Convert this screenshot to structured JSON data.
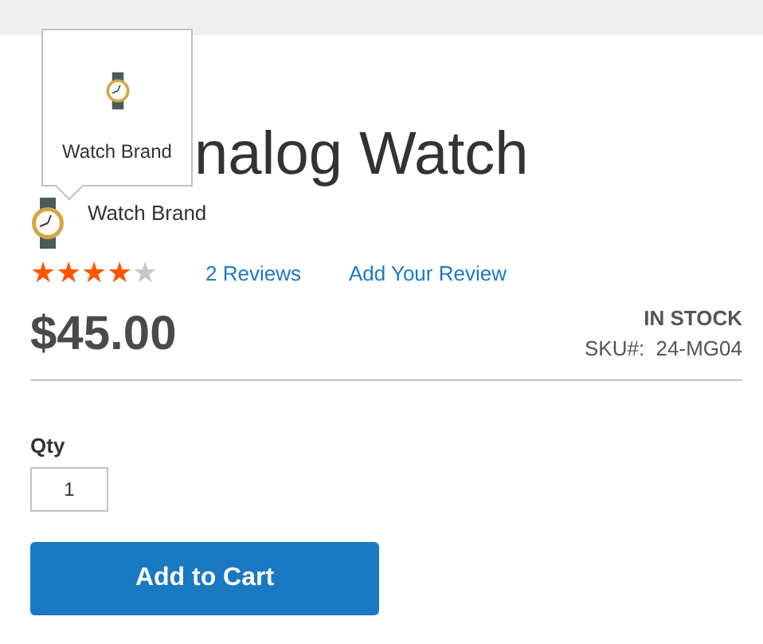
{
  "product": {
    "title": "nalog Watch",
    "brand": {
      "name": "Watch Brand"
    },
    "rating": {
      "stars": 4
    },
    "reviews_link": "2  Reviews",
    "add_review_link": "Add Your Review",
    "price": "$45.00",
    "stock": "IN STOCK",
    "sku_label": "SKU#:",
    "sku": "24-MG04"
  },
  "tooltip": {
    "label": "Watch Brand"
  },
  "qty": {
    "label": "Qty",
    "value": "1"
  },
  "add_to_cart": "Add to Cart"
}
